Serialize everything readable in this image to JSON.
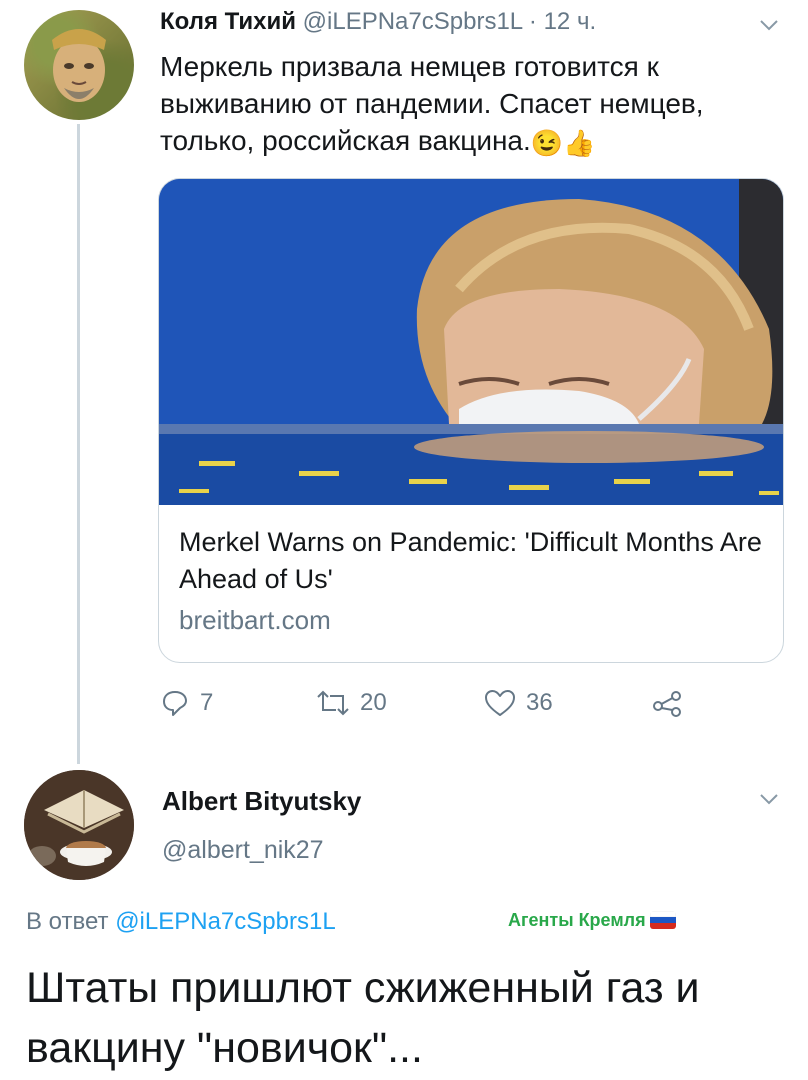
{
  "tweet1": {
    "author_name": "Коля Тихий",
    "handle": "@iLEPNa7cSpbrs1L",
    "separator": " · ",
    "time": "12 ч.",
    "text": "Меркель призвала немцев готовится к выживанию от пандемии. Спасет немцев, только, российская вакцина.",
    "emoji_wink": "😉",
    "emoji_thumb": "👍",
    "card": {
      "title": "Merkel Warns on Pandemic: 'Difficult Months Are Ahead of Us'",
      "domain": "breitbart.com"
    },
    "actions": {
      "replies": "7",
      "retweets": "20",
      "likes": "36"
    }
  },
  "tweet2": {
    "author_name": "Albert Bityutsky",
    "handle": "@albert_nik27",
    "reply_prefix": "В ответ ",
    "reply_handle": "@iLEPNa7cSpbrs1L",
    "text": "Штаты пришлют сжиженный газ и вакцину \"новичок\"..."
  },
  "watermark": {
    "text": "Агенты Кремля"
  },
  "colors": {
    "secondary_text": "#657786",
    "link": "#1da1f2",
    "watermark": "#29a84a",
    "border": "#ccd6dd"
  }
}
